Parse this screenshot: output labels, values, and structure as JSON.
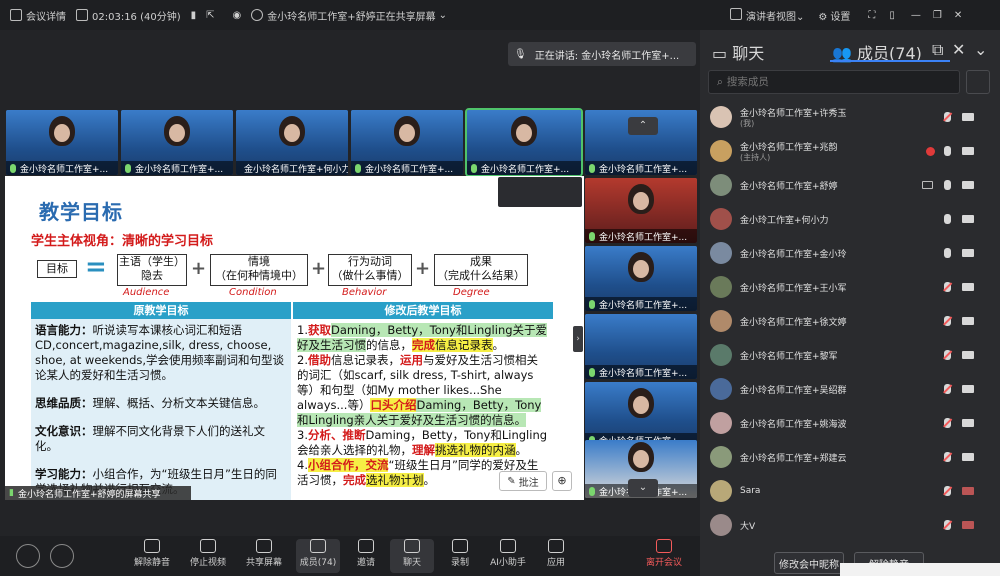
{
  "topbar": {
    "meeting_info": "会议详情",
    "duration": "02:03:16 (40分钟)",
    "share_status": "金小玲名师工作室+舒婷正在共享屏幕",
    "presenter_view": "演讲者视图",
    "settings": "设置"
  },
  "speaking": {
    "label": "正在讲话:",
    "name": "金小玲名师工作室+..."
  },
  "video_tiles": [
    {
      "name": "金小玲名师工作室+..."
    },
    {
      "name": "金小玲名师工作室+..."
    },
    {
      "name": "金小玲名师工作室+何小力"
    },
    {
      "name": "金小玲名师工作室+..."
    },
    {
      "name": "金小玲名师工作室+..."
    },
    {
      "name": "金小玲名师工作室+..."
    },
    {
      "name": "金小玲名师工作室+..."
    },
    {
      "name": "金小玲名师工作室+..."
    },
    {
      "name": "金小玲名师工作室+..."
    },
    {
      "name": "金小玲名师工作室+..."
    },
    {
      "name": "金小玲名师工作室+..."
    },
    {
      "name": "金小玲名师工作室+..."
    },
    {
      "name": "金小玲名师工作室+..."
    }
  ],
  "slide": {
    "title": "教学目标",
    "subtitle": "学生主体视角：清晰的学习目标",
    "formula": {
      "goal": "目标",
      "eq": "=",
      "b1_l1": "主语（学生）",
      "b1_l2": "隐去",
      "b2_l1": "情境",
      "b2_l2": "（在何种情境中）",
      "b3_l1": "行为动词",
      "b3_l2": "（做什么事情）",
      "b4_l1": "成果",
      "b4_l2": "（完成什么结果）",
      "plus": "+",
      "lab1": "Audience",
      "lab2": "Condition",
      "lab3": "Behavior",
      "lab4": "Degree"
    },
    "header_left": "原教学目标",
    "header_right": "修改后教学目标",
    "left": {
      "p1_label": "语言能力：",
      "p1_text": "听说读写本课核心词汇和短语CD,concert,magazine,silk, dress, choose, shoe, at weekends,学会使用频率副词和句型谈论某人的爱好和生活习惯。",
      "p2_label": "思维品质：",
      "p2_text": "理解、概括、分析文本关键信息。",
      "p3_label": "文化意识：",
      "p3_text": "理解不同文化背景下人们的送礼文化。",
      "p4_label": "学习能力：",
      "p4_text": "小组合作，为“班级生日月”生日的同学选择礼物并进行相互交流。"
    },
    "right": {
      "r1a": "1.",
      "r1b": "获取",
      "r1c": "Daming，Betty，Tony和Lingling关于爱好及生活习惯",
      "r1d": "的信息，",
      "r1e": "完成",
      "r1f": "信息记录表",
      "r1g": "。",
      "r2a": "2.",
      "r2b": "借助",
      "r2c": "信息记录表，",
      "r2d": "运用",
      "r2e": "与爱好及生活习惯相关的词汇（如scarf, silk dress, T-shirt, always等）和句型（如My mother likes...She always...等）",
      "r2f": "口头介绍",
      "r2g": "Daming，Betty，Tony和Lingling亲人关于爱好及生活习惯的信息。",
      "r3a": "3.",
      "r3b": "分析、推断",
      "r3c": "Daming，Betty，Tony和Lingling会给亲人选择的礼物，",
      "r3d": "理解",
      "r3e": "挑选礼物的内涵",
      "r3f": "。",
      "r4a": "4.",
      "r4b": "小组合作，",
      "r4c": "交流",
      "r4d": "“班级生日月”同学的爱好及生活习惯，",
      "r4e": "完成",
      "r4f": "选礼物计划",
      "r4g": "。"
    }
  },
  "share_caption": "金小玲名师工作室+舒婷的屏幕共享",
  "annotate_label": "批注",
  "toolbar": [
    {
      "label": "解除静音"
    },
    {
      "label": "停止视频"
    },
    {
      "label": "共享屏幕"
    },
    {
      "label": "成员(74)"
    },
    {
      "label": "邀请"
    },
    {
      "label": "聊天"
    },
    {
      "label": "录制"
    },
    {
      "label": "AI小助手"
    },
    {
      "label": "应用"
    },
    {
      "label": "离开会议"
    }
  ],
  "panel": {
    "tab_chat": "聊天",
    "tab_members": "成员(74)",
    "search_placeholder": "搜索成员",
    "members": [
      {
        "name": "金小玲名师工作室+许秀玉",
        "role": "(我)"
      },
      {
        "name": "金小玲名师工作室+兆韵",
        "role": "(主持人)"
      },
      {
        "name": "金小玲名师工作室+舒婷",
        "role": ""
      },
      {
        "name": "金小玲工作室+何小力",
        "role": ""
      },
      {
        "name": "金小玲名师工作室+金小玲",
        "role": ""
      },
      {
        "name": "金小玲名师工作室+王小军",
        "role": ""
      },
      {
        "name": "金小玲名师工作室+徐文婷",
        "role": ""
      },
      {
        "name": "金小玲名师工作室+黎军",
        "role": ""
      },
      {
        "name": "金小玲名师工作室+吴绍群",
        "role": ""
      },
      {
        "name": "金小玲名师工作室+姚海波",
        "role": ""
      },
      {
        "name": "金小玲名师工作室+郑建云",
        "role": ""
      },
      {
        "name": "Sara",
        "role": ""
      },
      {
        "name": "大V",
        "role": ""
      }
    ],
    "btn_rename": "修改会中昵称",
    "btn_mute_all": "解除静音"
  }
}
